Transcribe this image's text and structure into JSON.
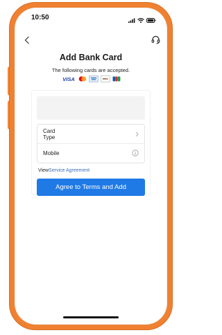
{
  "status_bar": {
    "time": "10:50",
    "icons": [
      "signal-icon",
      "wifi-icon",
      "battery-icon"
    ]
  },
  "nav": {
    "back_icon": "chevron-left-icon",
    "support_icon": "headset-icon"
  },
  "page": {
    "title": "Add Bank Card",
    "subtitle": "The following cards are accepted.",
    "accepted_cards": [
      "VISA",
      "mastercard-logo",
      "amex-logo",
      "discover-logo",
      "jcb-logo"
    ]
  },
  "form": {
    "card_type_label": "Card\nType",
    "mobile_label": "Mobile"
  },
  "agreement": {
    "prefix": "View",
    "link_text": "Service Agreement"
  },
  "actions": {
    "submit_label": "Agree to Terms and Add"
  },
  "colors": {
    "phone_frame": "#ef8131",
    "primary": "#1f7ae5",
    "link": "#3a6db8"
  }
}
